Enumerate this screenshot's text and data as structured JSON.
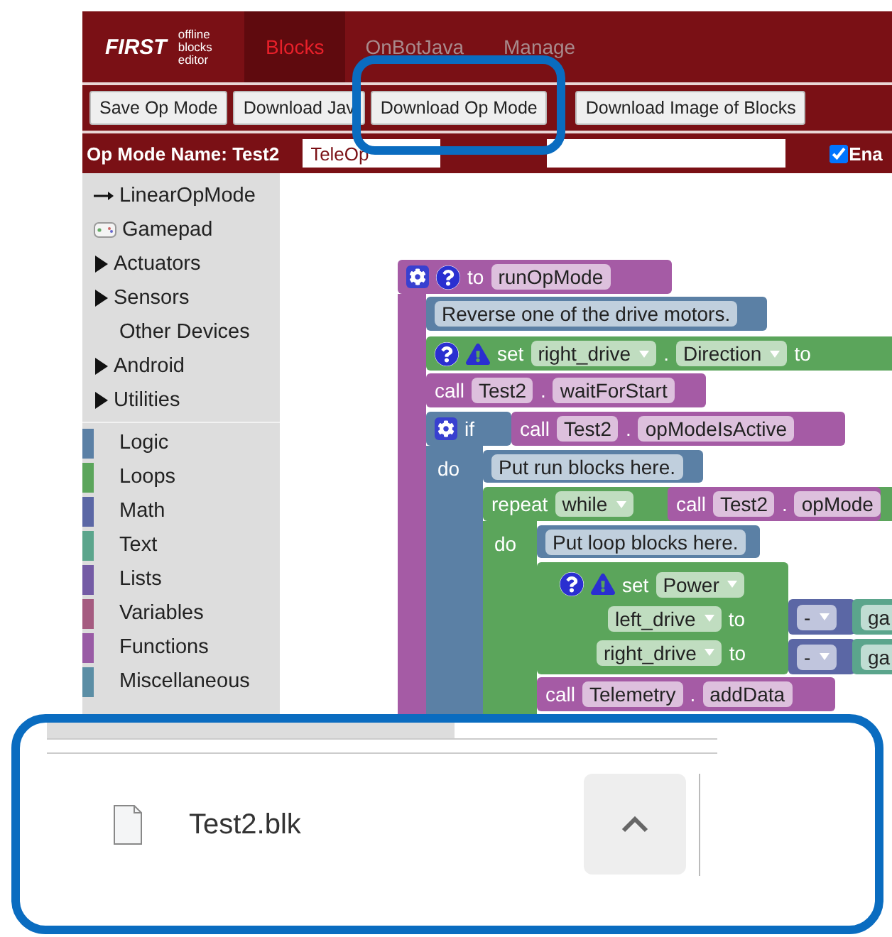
{
  "header": {
    "logo": "FIRST",
    "logo_caption": "offline blocks editor",
    "tabs": [
      {
        "label": "Blocks",
        "selected": true
      },
      {
        "label": "OnBotJava",
        "selected": false
      },
      {
        "label": "Manage",
        "selected": false
      }
    ]
  },
  "toolbar": {
    "buttons": [
      "Save Op Mode",
      "Download Jav",
      "Download Op Mode",
      "Download Image of Blocks"
    ]
  },
  "op_mode_row": {
    "name_label": "Op Mode Name: Test2",
    "flavor": "TeleOp",
    "enabled": {
      "label": "Ena",
      "checked": true
    }
  },
  "sidebar": {
    "items": [
      {
        "kind": "link",
        "label": "LinearOpMode"
      },
      {
        "kind": "gamepad",
        "label": "Gamepad"
      },
      {
        "kind": "folder",
        "label": "Actuators",
        "expanded": false
      },
      {
        "kind": "folder",
        "label": "Sensors",
        "expanded": false
      },
      {
        "kind": "plain",
        "label": "Other Devices"
      },
      {
        "kind": "folder",
        "label": "Android",
        "expanded": false
      },
      {
        "kind": "folder",
        "label": "Utilities",
        "expanded": false
      }
    ],
    "categories": [
      {
        "label": "Logic",
        "color": "#5b80a5"
      },
      {
        "label": "Loops",
        "color": "#5ba55b"
      },
      {
        "label": "Math",
        "color": "#5b67a5"
      },
      {
        "label": "Text",
        "color": "#5ba58c"
      },
      {
        "label": "Lists",
        "color": "#745ba5"
      },
      {
        "label": "Variables",
        "color": "#a55b80"
      },
      {
        "label": "Functions",
        "color": "#995ba5"
      },
      {
        "label": "Miscellaneous",
        "color": "#5b8ea5"
      }
    ]
  },
  "canvas": {
    "arms": [
      {
        "color": "#a55ba5"
      },
      {
        "color": "#5b80a5",
        "label": "do"
      },
      {
        "color": "#5ba55b",
        "label": "do"
      }
    ],
    "blocks": [
      {
        "color": "#a55ba5",
        "rows": [
          [
            {
              "kind": "gear"
            },
            {
              "kind": "help"
            },
            {
              "kind": "label",
              "text": "to"
            },
            {
              "kind": "field",
              "text": "runOpMode"
            }
          ]
        ]
      },
      {
        "color": "#5b80a5",
        "rows": [
          [
            {
              "kind": "field",
              "text": "Reverse one of the drive motors."
            }
          ]
        ]
      },
      {
        "color": "#5ba55b",
        "rows": [
          [
            {
              "kind": "help"
            },
            {
              "kind": "warning"
            },
            {
              "kind": "label",
              "text": "set"
            },
            {
              "kind": "dropdown",
              "text": "right_drive"
            },
            {
              "kind": "label",
              "text": "."
            },
            {
              "kind": "dropdown",
              "text": "Direction"
            },
            {
              "kind": "label",
              "text": "to"
            }
          ]
        ]
      },
      {
        "color": "#a55ba5",
        "rows": [
          [
            {
              "kind": "label",
              "text": "call"
            },
            {
              "kind": "field",
              "text": "Test2"
            },
            {
              "kind": "label",
              "text": "."
            },
            {
              "kind": "field",
              "text": "waitForStart"
            }
          ]
        ]
      },
      {
        "color": "#5b80a5",
        "rows": [
          [
            {
              "kind": "gear"
            },
            {
              "kind": "label",
              "text": "if"
            }
          ]
        ]
      },
      {
        "color": "#a55ba5",
        "rows": [
          [
            {
              "kind": "label",
              "text": "call"
            },
            {
              "kind": "field",
              "text": "Test2"
            },
            {
              "kind": "label",
              "text": "."
            },
            {
              "kind": "field",
              "text": "opModeIsActive"
            }
          ]
        ]
      },
      {
        "color": "#5b80a5",
        "rows": [
          [
            {
              "kind": "field",
              "text": "Put run blocks here."
            }
          ]
        ]
      },
      {
        "color": "#5ba55b",
        "rows": [
          [
            {
              "kind": "label",
              "text": "repeat"
            },
            {
              "kind": "dropdown",
              "text": "while"
            }
          ]
        ]
      },
      {
        "color": "#a55ba5",
        "rows": [
          [
            {
              "kind": "label",
              "text": "call"
            },
            {
              "kind": "field",
              "text": "Test2"
            },
            {
              "kind": "label",
              "text": "."
            },
            {
              "kind": "field",
              "text": "opMode"
            }
          ]
        ]
      },
      {
        "color": "#5b80a5",
        "rows": [
          [
            {
              "kind": "field",
              "text": "Put loop blocks here."
            }
          ]
        ]
      },
      {
        "color": "#5ba55b",
        "rows": [
          [
            {
              "kind": "help"
            },
            {
              "kind": "warning"
            },
            {
              "kind": "label",
              "text": "set"
            },
            {
              "kind": "dropdown",
              "text": "Power"
            }
          ],
          [
            {
              "kind": "dropdown",
              "text": "left_drive"
            },
            {
              "kind": "label",
              "text": "to"
            }
          ],
          [
            {
              "kind": "dropdown",
              "text": "right_drive"
            },
            {
              "kind": "label",
              "text": "to"
            }
          ]
        ]
      },
      {
        "color": "#5b67a5",
        "rows": [
          [
            {
              "kind": "dropdown",
              "text": "-"
            }
          ]
        ]
      },
      {
        "color": "#5b67a5",
        "rows": [
          [
            {
              "kind": "dropdown",
              "text": "-"
            }
          ]
        ]
      },
      {
        "color": "#5ba58c",
        "rows": [
          [
            {
              "kind": "field",
              "text": "ga"
            }
          ]
        ]
      },
      {
        "color": "#5ba58c",
        "rows": [
          [
            {
              "kind": "field",
              "text": "ga"
            }
          ]
        ]
      },
      {
        "color": "#a55ba5",
        "rows": [
          [
            {
              "kind": "label",
              "text": "call"
            },
            {
              "kind": "field",
              "text": "Telemetry"
            },
            {
              "kind": "label",
              "text": "."
            },
            {
              "kind": "field",
              "text": "addData"
            }
          ]
        ]
      }
    ]
  },
  "download_bar": {
    "file_name": "Test2.blk"
  }
}
